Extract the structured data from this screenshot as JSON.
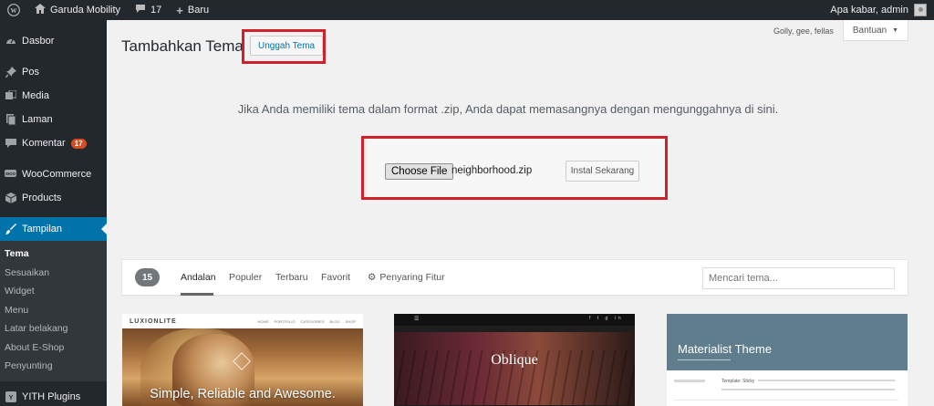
{
  "adminbar": {
    "site_name": "Garuda Mobility",
    "comments_count": "17",
    "new_label": "Baru",
    "howdy": "Apa kabar, admin"
  },
  "sidebar": {
    "items": [
      {
        "label": "Dasbor",
        "icon": "dashboard-icon"
      },
      {
        "label": "Pos",
        "icon": "pin-icon"
      },
      {
        "label": "Media",
        "icon": "media-icon"
      },
      {
        "label": "Laman",
        "icon": "page-icon"
      },
      {
        "label": "Komentar",
        "icon": "comment-icon",
        "badge": "17"
      },
      {
        "label": "WooCommerce",
        "icon": "woocommerce-icon"
      },
      {
        "label": "Products",
        "icon": "box-icon"
      },
      {
        "label": "Tampilan",
        "icon": "brush-icon"
      },
      {
        "label": "YITH Plugins",
        "icon": "yith-icon"
      }
    ],
    "submenu": [
      "Tema",
      "Sesuaikan",
      "Widget",
      "Menu",
      "Latar belakang",
      "About E-Shop",
      "Penyunting"
    ]
  },
  "header": {
    "title": "Tambahkan Tema",
    "upload_button": "Unggah Tema",
    "note": "Golly, gee, fellas",
    "help": "Bantuan"
  },
  "upload": {
    "instructions": "Jika Anda memiliki tema dalam format .zip, Anda dapat memasangnya dengan mengunggahnya di sini.",
    "choose_file": "Choose File",
    "file_name": "neighborhood.zip",
    "install": "Instal Sekarang"
  },
  "filter": {
    "count": "15",
    "tabs": [
      "Andalan",
      "Populer",
      "Terbaru",
      "Favorit"
    ],
    "active_tab": "Andalan",
    "feature_filter": "Penyaring Fitur",
    "search_placeholder": "Mencari tema..."
  },
  "themes": [
    {
      "logo": "LUXIONLITE",
      "nav": [
        "HOME",
        "PORTFOLIO",
        "CATEGORIES",
        "BLOG",
        "SHOP"
      ],
      "tagline": "Simple, Reliable and Awesome."
    },
    {
      "name": "Oblique"
    },
    {
      "name": "Materialist Theme",
      "post_title": "Template: Sticky"
    }
  ],
  "colors": {
    "accent": "#0073aa",
    "highlight": "#d0202a",
    "sidebar": "#23282d"
  }
}
